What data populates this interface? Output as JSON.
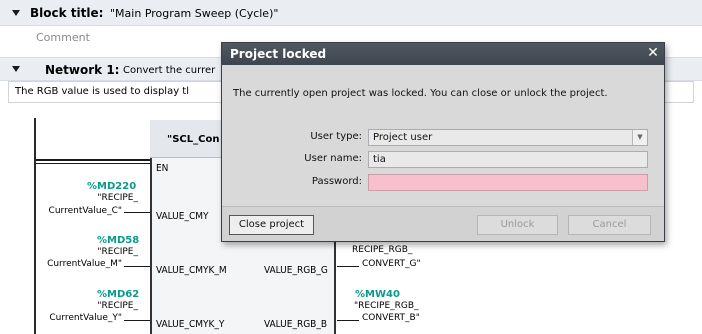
{
  "block": {
    "title_label": "Block title:",
    "title_value": "\"Main Program Sweep (Cycle)\"",
    "comment": "Comment"
  },
  "network": {
    "label": "Network 1:",
    "title": "Convert the currer",
    "comment": "The RGB value is used to display tl"
  },
  "fbd": {
    "block_name": "\"SCL_Con",
    "en_pin": "EN",
    "inputs": [
      {
        "address": "%MD220",
        "symbol_line1": "\"RECIPE_",
        "symbol_line2": "CurrentValue_C\"",
        "pin": "VALUE_CMY"
      },
      {
        "address": "%MD58",
        "symbol_line1": "\"RECIPE_",
        "symbol_line2": "CurrentValue_M\"",
        "pin": "VALUE_CMYK_M"
      },
      {
        "address": "%MD62",
        "symbol_line1": "\"RECIPE_",
        "symbol_line2": "CurrentValue_Y\"",
        "pin": "VALUE_CMYK_Y"
      }
    ],
    "outputs": [
      {
        "pin": "VALUE_RGB_G",
        "address": "",
        "symbol_line1": "RECIPE_RGB_",
        "symbol_line2": "CONVERT_G\""
      },
      {
        "pin": "VALUE_RGB_B",
        "address": "%MW40",
        "symbol_line1": "\"RECIPE_RGB_",
        "symbol_line2": "CONVERT_B\""
      }
    ]
  },
  "dialog": {
    "title": "Project locked",
    "close_glyph": "✕",
    "message": "The currently open project was locked. You can close or unlock the project.",
    "user_type_label": "User type:",
    "user_type_value": "Project user",
    "user_name_label": "User name:",
    "user_name_value": "tia",
    "password_label": "Password:",
    "password_value": "",
    "close_project_label": "Close project",
    "unlock_label": "Unlock",
    "cancel_label": "Cancel"
  },
  "colors": {
    "address_teal": "#0a9a8a",
    "password_pink": "#f7c0cc",
    "title_bar": "#464d56"
  }
}
